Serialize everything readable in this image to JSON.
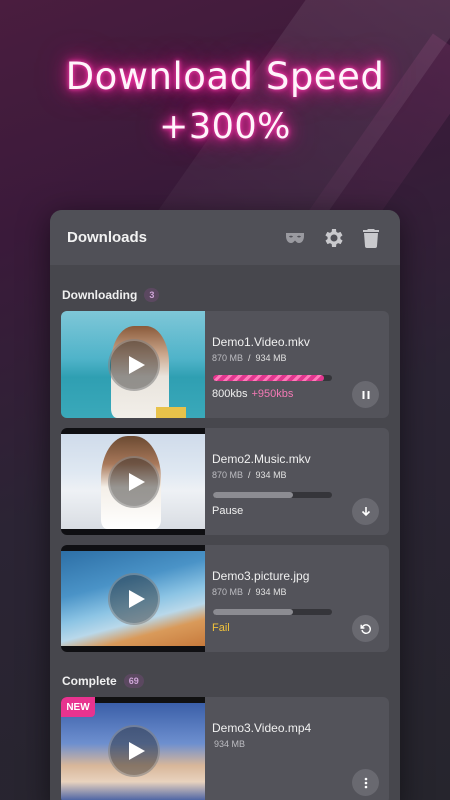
{
  "hero": {
    "line1": "Download Speed",
    "line2": "+300%"
  },
  "panel": {
    "title": "Downloads",
    "header_icons": [
      "incognito-mask-icon",
      "gear-icon",
      "trash-icon"
    ]
  },
  "downloading": {
    "label": "Downloading",
    "count": "3",
    "items": [
      {
        "name": "Demo1.Video.mkv",
        "downloaded": "870 MB",
        "separator": "/",
        "total": "934 MB",
        "progress": 0.93,
        "active": true,
        "status": "800kbs",
        "speed_boost": "+950kbs",
        "action_icon": "pause-icon"
      },
      {
        "name": "Demo2.Music.mkv",
        "downloaded": "870 MB",
        "separator": "/",
        "total": "934 MB",
        "progress": 0.67,
        "active": false,
        "status": "Pause",
        "action_icon": "download-arrow-icon"
      },
      {
        "name": "Demo3.picture.jpg",
        "downloaded": "870 MB",
        "separator": "/",
        "total": "934 MB",
        "progress": 0.67,
        "active": false,
        "status": "Fail",
        "action_icon": "retry-icon"
      }
    ]
  },
  "complete": {
    "label": "Complete",
    "count": "69",
    "items": [
      {
        "name": "Demo3.Video.mp4",
        "size": "934 MB",
        "badge": "NEW",
        "action_icon": "more-vertical-icon"
      }
    ]
  },
  "colors": {
    "accent": "#e8338f",
    "fail": "#f0c23b",
    "speed_boost": "#f47ab6"
  }
}
